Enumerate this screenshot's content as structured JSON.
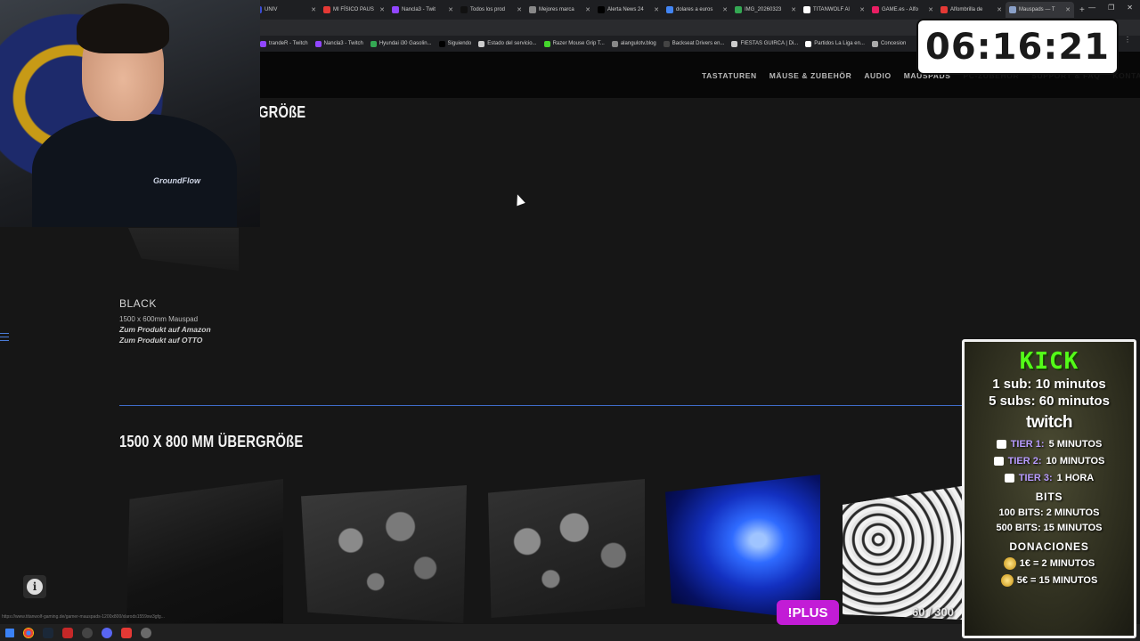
{
  "browser": {
    "tabs": [
      {
        "label": "UNIV",
        "color": "#3a4bd4"
      },
      {
        "label": "MI FÍSICO PAUS",
        "color": "#e53935"
      },
      {
        "label": "Nancla3 - Twit",
        "color": "#9146ff"
      },
      {
        "label": "Todos los prod",
        "color": "#111111"
      },
      {
        "label": "Mejores marca",
        "color": "#888888"
      },
      {
        "label": "Alerta News 24",
        "color": "#000000"
      },
      {
        "label": "dolares a euros",
        "color": "#4285f4"
      },
      {
        "label": "IMG_20260323",
        "color": "#34a853"
      },
      {
        "label": "TITANWOLF Al",
        "color": "#ffffff"
      },
      {
        "label": "GAME.es - Alfo",
        "color": "#e91e63"
      },
      {
        "label": "Alfombrilla de",
        "color": "#e53935"
      },
      {
        "label": "Mauspads — T",
        "color": "#8aa0c8",
        "active": true
      }
    ],
    "bookmarks": [
      {
        "label": "trandeR - Twitch",
        "color": "#9146ff"
      },
      {
        "label": "Nancla3 - Twitch",
        "color": "#9146ff"
      },
      {
        "label": "Hyundai i30 Gasolin...",
        "color": "#34a853"
      },
      {
        "label": "Siguiendo",
        "color": "#000000"
      },
      {
        "label": "Estado del servicio...",
        "color": "#cccccc"
      },
      {
        "label": "Razer Mouse Grip T...",
        "color": "#44d62c"
      },
      {
        "label": "alangulotv.blog",
        "color": "#888888"
      },
      {
        "label": "Backseat Drivers en...",
        "color": "#444444"
      },
      {
        "label": "FIESTAS GUIRCA | Di...",
        "color": "#cccccc"
      },
      {
        "label": "Partidos La Liga en...",
        "color": "#ffffff"
      },
      {
        "label": "Concesion",
        "color": "#aaaaaa"
      }
    ],
    "status_url": "https://www.titanwolf-gaming.de/gamer-mauspads-1200x800/xlarods1559sw3gfg..."
  },
  "site": {
    "nav": [
      "TASTATUREN",
      "MÄUSE & ZUBEHÖR",
      "AUDIO",
      "MAUSPADS",
      "PC-ZUBEHÖR",
      "SUPPORT & FAQ",
      "KONTAKT"
    ],
    "section1_title": "GRÖßE",
    "product": {
      "name": "BLACK",
      "size": "1500 x 600mm Mauspad",
      "link_amazon": "Zum Produkt auf Amazon",
      "link_otto": "Zum Produkt auf OTTO"
    },
    "section2_title": "1500 X 800 MM ÜBERGRÖßE",
    "accent_color": "#3f6cc9"
  },
  "overlay": {
    "timer": "06:16:21",
    "plus_label": "!PLUS",
    "goal_label": "60 / 300",
    "kick_title": "KICK",
    "kick_lines": [
      "1 sub: 10 minutos",
      "5 subs: 60 minutos"
    ],
    "twitch_title": "twitch",
    "tiers": [
      {
        "name": "TIER 1:",
        "value": "5 MINUTOS"
      },
      {
        "name": "TIER 2:",
        "value": "10 MINUTOS"
      },
      {
        "name": "TIER 3:",
        "value": "1 HORA"
      }
    ],
    "bits_title": "BITS",
    "bits": [
      "100 BITS: 2 MINUTOS",
      "500 BITS: 15 MINUTOS"
    ],
    "donations_title": "DONACIONES",
    "donations": [
      "1€ = 2 MINUTOS",
      "5€ = 15 MINUTOS"
    ],
    "kick_color": "#53fc18",
    "plus_color": "#c21cd6",
    "shirt_text": "GroundFlow"
  }
}
